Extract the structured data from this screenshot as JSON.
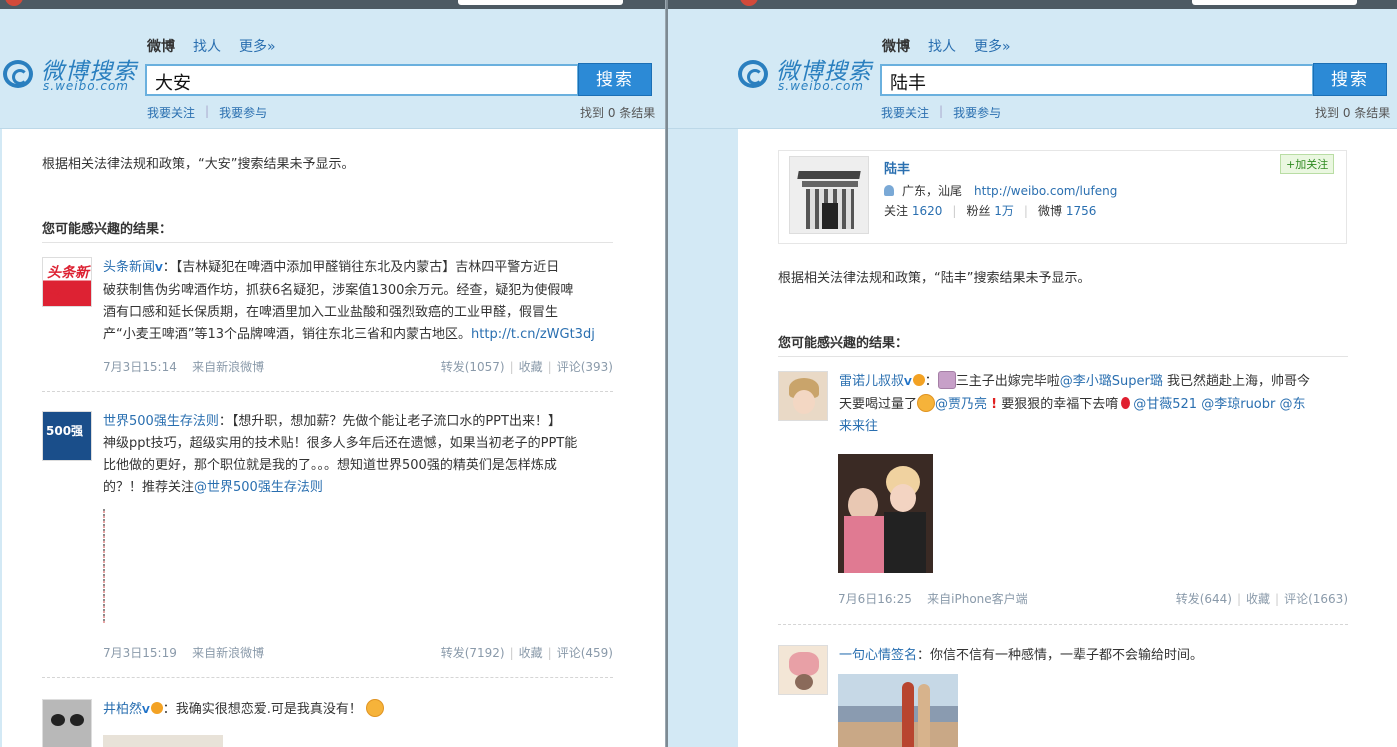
{
  "left": {
    "nav": {
      "current": "微博",
      "people": "找人",
      "more": "更多»"
    },
    "logo": {
      "title": "微博搜索",
      "sub": "s.weibo.com"
    },
    "search": {
      "query": "大安",
      "button": "搜索"
    },
    "links": {
      "my_follow": "我要关注",
      "my_join": "我要参与"
    },
    "count": "找到 0 条结果",
    "notice": "根据相关法律法规和政策，“大安”搜索结果未予显示。",
    "section_title": "您可能感兴趣的结果：",
    "posts": [
      {
        "name": "头条新闻",
        "badge": "V",
        "lines": [
          "：【吉林疑犯在啤酒中添加甲醛销往东北及内蒙古】吉林四平警方近日",
          "破获制售伪劣啤酒作坊，抓获6名疑犯，涉案值1300余万元。经查，疑犯为使假啤",
          "酒有口感和延长保质期，在啤酒里加入工业盐酸和强烈致癌的工业甲醛，假冒生",
          "产“小麦王啤酒”等13个品牌啤酒，销往东北三省和内蒙古地区。"
        ],
        "link": "http://t.cn/zWGt3dj",
        "time": "7月3日15:14",
        "from_label": "来自",
        "from": "新浪微博",
        "repost": "转发(1057)",
        "fav": "收藏",
        "comment": "评论(393)",
        "avatar_text": "头条新闻"
      },
      {
        "name": "世界500强生存法则",
        "lines": [
          "：【想升职，想加薪？先做个能让老子流口水的PPT出来！】",
          "神级ppt技巧，超级实用的技术贴！很多人多年后还在遗憾，如果当初老子的PPT能",
          "比他做的更好，那个职位就是我的了。。。想知道世界500强的精英们是怎样炼成",
          "的？！推荐关注"
        ],
        "mention": "@世界500强生存法则",
        "time": "7月3日15:19",
        "from_label": "来自",
        "from": "新浪微博",
        "repost": "转发(7192)",
        "fav": "收藏",
        "comment": "评论(459)",
        "avatar_text": "500强"
      },
      {
        "name": "井柏然",
        "badge": "V",
        "lines": [
          "：我确实很想恋爱.可是我真没有！"
        ]
      }
    ]
  },
  "right": {
    "nav": {
      "current": "微博",
      "people": "找人",
      "more": "更多»"
    },
    "logo": {
      "title": "微博搜索",
      "sub": "s.weibo.com"
    },
    "search": {
      "query": "陆丰",
      "button": "搜索"
    },
    "links": {
      "my_follow": "我要关注",
      "my_join": "我要参与"
    },
    "count": "找到 0 条结果",
    "user": {
      "name": "陆丰",
      "location": "广东，汕尾",
      "url": "http://weibo.com/lufeng",
      "follow_label": "关注",
      "follow": "1620",
      "fans_label": "粉丝",
      "fans": "1万",
      "weibo_label": "微博",
      "weibo": "1756",
      "add_follow": "+加关注"
    },
    "notice": "根据相关法律法规和政策，“陆丰”搜索结果未予显示。",
    "section_title": "您可能感兴趣的结果：",
    "posts": [
      {
        "name": "雷诺儿叔叔",
        "badge": "V",
        "line1_a": "：",
        "line1_b": "三主子出嫁完毕啦",
        "mention1": "@李小璐Super璐",
        "line1_c": " 我已然趟赴上海，帅哥今",
        "line2_a": "天要喝过量了",
        "mention2": "@贾乃亮",
        "line2_b": " 要狠狠的幸福下去唷",
        "mention3": "@甘薇521",
        "mention4": "@李琼ruobr",
        "mention5": "@东",
        "line3": "来来往",
        "time": "7月6日16:25",
        "from_label": "来自",
        "from": "iPhone客户端",
        "repost": "转发(644)",
        "fav": "收藏",
        "comment": "评论(1663)"
      },
      {
        "name": "一句心情签名",
        "text": "：你信不信有一种感情，一辈子都不会输给时间。"
      }
    ]
  }
}
